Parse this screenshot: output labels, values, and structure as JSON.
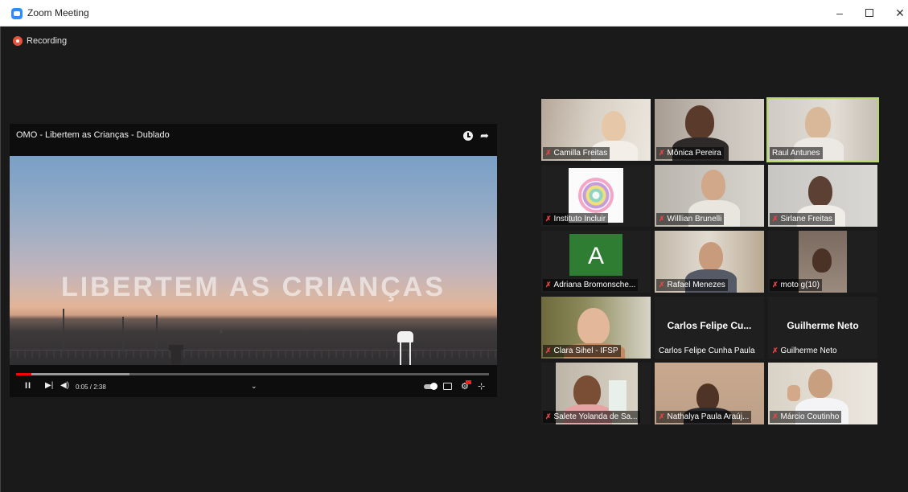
{
  "window": {
    "title": "Zoom Meeting",
    "minimize_glyph": "–",
    "close_glyph": "✕"
  },
  "recording": {
    "label": "Recording"
  },
  "shared_video": {
    "title": "OMO - Libertem as Crianças - Dublado",
    "overlay_text": "LIBERTEM AS CRIANÇAS",
    "time": "0:05 / 2:38",
    "progress": 0.032,
    "buffered": 0.24,
    "play_glyph": "II",
    "next_glyph": "▶|",
    "volume_glyph": "◀)",
    "chevron_glyph": "⌄",
    "settings_glyph": "⚙",
    "fullscreen_glyph": "⊹",
    "share_glyph": "➦"
  },
  "participants": [
    {
      "name": "Camilla Freitas",
      "muted": true,
      "video": true,
      "active": false
    },
    {
      "name": "Mônica Pereira",
      "muted": true,
      "video": true,
      "active": false
    },
    {
      "name": "Raul Antunes",
      "muted": false,
      "video": true,
      "active": true
    },
    {
      "name": "Instituto Incluir",
      "muted": true,
      "video": true,
      "active": false
    },
    {
      "name": "Willlian Brunelli",
      "muted": true,
      "video": true,
      "active": false
    },
    {
      "name": "Sirlane Freitas",
      "muted": true,
      "video": true,
      "active": false
    },
    {
      "name": "Adriana Bromonsche...",
      "muted": true,
      "video": false,
      "avatar_letter": "A",
      "avatar_color": "#2e7d32",
      "active": false
    },
    {
      "name": "Rafael Menezes",
      "muted": true,
      "video": true,
      "active": false
    },
    {
      "name": "moto g(10)",
      "muted": true,
      "video": true,
      "active": false
    },
    {
      "name": "Clara Sihel - IFSP",
      "muted": true,
      "video": true,
      "active": false
    },
    {
      "name": "Carlos Felipe Cunha Paula",
      "display": "Carlos  Felipe  Cu...",
      "muted": false,
      "video": false,
      "active": false
    },
    {
      "name": "Guilherme Neto",
      "display": "Guilherme Neto",
      "muted": true,
      "video": false,
      "active": false
    },
    {
      "name": "Salete Yolanda de Sa...",
      "muted": true,
      "video": true,
      "active": false
    },
    {
      "name": "Nathalya Paula Araúj...",
      "muted": true,
      "video": true,
      "active": false
    },
    {
      "name": "Márcio Coutinho",
      "muted": true,
      "video": true,
      "active": false
    }
  ],
  "icons": {
    "muted": "mic-muted-icon",
    "recording": "record-dot-icon"
  },
  "colors": {
    "active_speaker": "#b8d96a",
    "muted_mic": "#e64545",
    "recording": "#e5533b"
  }
}
